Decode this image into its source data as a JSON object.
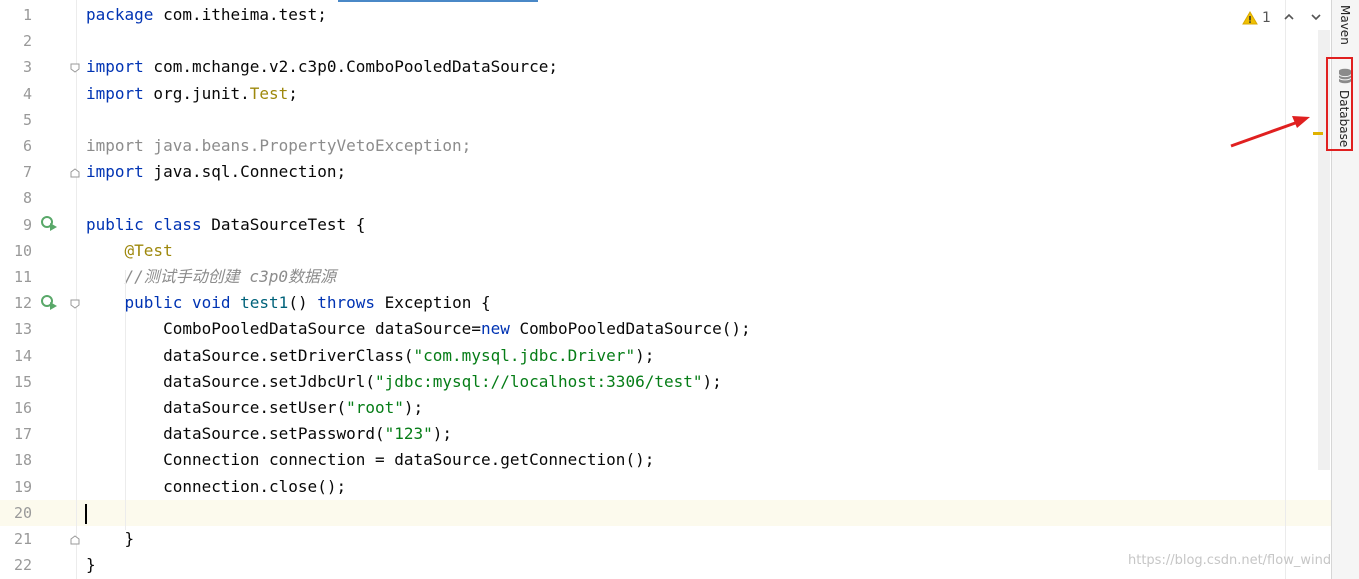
{
  "editor": {
    "lines": [
      {
        "n": "1",
        "html": "<span class='kw'>package</span> com.itheima.test;"
      },
      {
        "n": "2",
        "html": ""
      },
      {
        "n": "3",
        "html": "<span class='kw'>import</span> com.mchange.v2.c3p0.ComboPooledDataSource;"
      },
      {
        "n": "4",
        "html": "<span class='kw'>import</span> org.junit.<span class='cls'>Test</span>;"
      },
      {
        "n": "5",
        "html": ""
      },
      {
        "n": "6",
        "html": "<span class='grey'>import java.beans.PropertyVetoException;</span>"
      },
      {
        "n": "7",
        "html": "<span class='kw'>import</span> java.sql.Connection;"
      },
      {
        "n": "8",
        "html": ""
      },
      {
        "n": "9",
        "html": "<span class='kw'>public class</span> DataSourceTest {"
      },
      {
        "n": "10",
        "html": "    <span class='ann'>@Test</span>"
      },
      {
        "n": "11",
        "html": "    <span class='cmt'>//测试手动创建 c3p0数据源</span>"
      },
      {
        "n": "12",
        "html": "    <span class='kw'>public void</span> <span class='fn'>test1</span>() <span class='kw'>throws</span> Exception {"
      },
      {
        "n": "13",
        "html": "        ComboPooledDataSource dataSource=<span class='kw'>new</span> ComboPooledDataSource();"
      },
      {
        "n": "14",
        "html": "        dataSource.setDriverClass(<span class='str'>\"com.mysql.jdbc.Driver\"</span>);"
      },
      {
        "n": "15",
        "html": "        dataSource.setJdbcUrl(<span class='str'>\"jdbc:mysql://localhost:3306/test\"</span>);"
      },
      {
        "n": "16",
        "html": "        dataSource.setUser(<span class='str'>\"root\"</span>);"
      },
      {
        "n": "17",
        "html": "        dataSource.setPassword(<span class='str'>\"123\"</span>);"
      },
      {
        "n": "18",
        "html": "        Connection connection = dataSource.getConnection();"
      },
      {
        "n": "19",
        "html": "        connection.close();"
      },
      {
        "n": "20",
        "html": ""
      },
      {
        "n": "21",
        "html": "    }"
      },
      {
        "n": "22",
        "html": "}"
      }
    ],
    "current_line": "20"
  },
  "inspections": {
    "warning_count": "1"
  },
  "side_tabs": {
    "maven": "Maven",
    "database": "Database"
  },
  "watermark": "https://blog.csdn.net/flow_wind",
  "colors": {
    "keyword": "#0033b3",
    "string": "#067d17",
    "annotation": "#9e880d",
    "highlight": "#e02020"
  }
}
